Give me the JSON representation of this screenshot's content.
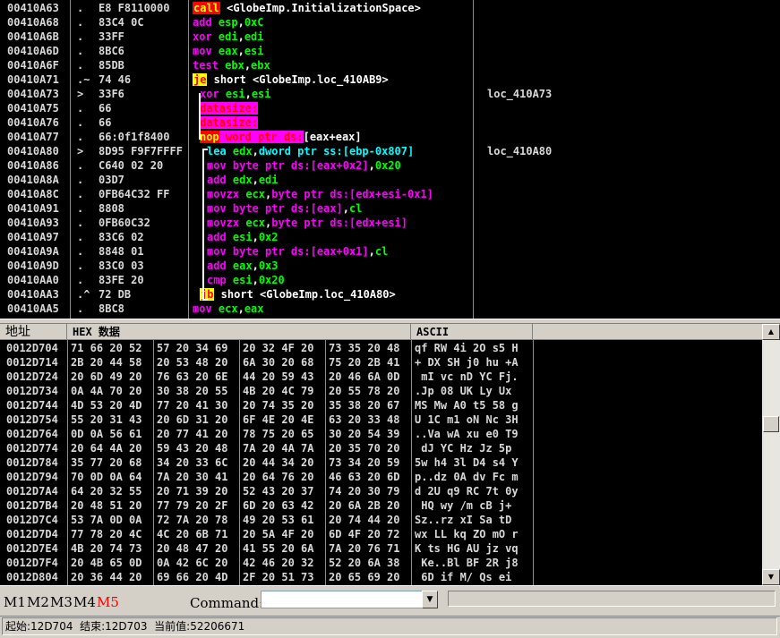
{
  "disasm": {
    "rows": [
      {
        "addr": "00410A63",
        "marker": ".",
        "hex": "E8 F8110000",
        "asm": [
          [
            "kw-call",
            "call"
          ],
          [
            "op-white",
            " <GlobeImp.InitializationSpace>"
          ]
        ],
        "comment": ""
      },
      {
        "addr": "00410A68",
        "marker": ".",
        "hex": "83C4 0C",
        "asm": [
          [
            "kw-add",
            "add "
          ],
          [
            "reg",
            "esp"
          ],
          [
            "op-white",
            ","
          ],
          [
            "num",
            "0xC"
          ]
        ],
        "comment": ""
      },
      {
        "addr": "00410A6B",
        "marker": ".",
        "hex": "33FF",
        "asm": [
          [
            "kw-xor",
            "xor "
          ],
          [
            "reg",
            "edi"
          ],
          [
            "op-white",
            ","
          ],
          [
            "reg",
            "edi"
          ]
        ],
        "comment": ""
      },
      {
        "addr": "00410A6D",
        "marker": ".",
        "hex": "8BC6",
        "asm": [
          [
            "kw-mov",
            "mov "
          ],
          [
            "reg",
            "eax"
          ],
          [
            "op-white",
            ","
          ],
          [
            "reg",
            "esi"
          ]
        ],
        "comment": ""
      },
      {
        "addr": "00410A6F",
        "marker": ".",
        "hex": "85DB",
        "asm": [
          [
            "kw-test",
            "test "
          ],
          [
            "reg",
            "ebx"
          ],
          [
            "op-white",
            ","
          ],
          [
            "reg",
            "ebx"
          ]
        ],
        "comment": ""
      },
      {
        "addr": "00410A71",
        "marker": ".~",
        "hex": "74 46",
        "asm": [
          [
            "kw-jmp",
            "je"
          ],
          [
            "op-white",
            " short <GlobeImp.loc_410AB9>"
          ]
        ],
        "comment": ""
      },
      {
        "addr": "00410A73",
        "marker": ">",
        "hex": "33F6",
        "asm": [
          [
            "kw-xor",
            "xor "
          ],
          [
            "reg",
            "esi"
          ],
          [
            "op-white",
            ","
          ],
          [
            "reg",
            "esi"
          ]
        ],
        "comment": "loc_410A73"
      },
      {
        "addr": "00410A75",
        "marker": ".",
        "hex": "66",
        "asm": [
          [
            "datasize",
            "datasize:"
          ]
        ],
        "comment": ""
      },
      {
        "addr": "00410A76",
        "marker": ".",
        "hex": "66",
        "asm": [
          [
            "datasize",
            "datasize:"
          ]
        ],
        "comment": ""
      },
      {
        "addr": "00410A77",
        "marker": ".",
        "hex": "66:0f1f8400",
        "asm": [
          [
            "nopbox",
            "nop"
          ],
          [
            "nopmag",
            " word ptr ds:"
          ],
          [
            "op-white",
            "[eax+eax]"
          ]
        ],
        "comment": ""
      },
      {
        "addr": "00410A80",
        "marker": ">",
        "hex": "8D95 F9F7FFFF",
        "asm": [
          [
            "kw-lea",
            "lea "
          ],
          [
            "reg",
            "edx"
          ],
          [
            "op-white",
            ","
          ],
          [
            "cyan",
            "dword ptr ss:[ebp-0x807]"
          ]
        ],
        "comment": "loc_410A80"
      },
      {
        "addr": "00410A86",
        "marker": ".",
        "hex": "C640 02 20",
        "asm": [
          [
            "kw-mov",
            "mov "
          ],
          [
            "mag",
            "byte ptr ds:[eax+0x2]"
          ],
          [
            "op-white",
            ","
          ],
          [
            "num",
            "0x20"
          ]
        ],
        "comment": ""
      },
      {
        "addr": "00410A8A",
        "marker": ".",
        "hex": "03D7",
        "asm": [
          [
            "kw-add",
            "add "
          ],
          [
            "reg",
            "edx"
          ],
          [
            "op-white",
            ","
          ],
          [
            "reg",
            "edi"
          ]
        ],
        "comment": ""
      },
      {
        "addr": "00410A8C",
        "marker": ".",
        "hex": "0FB64C32 FF",
        "asm": [
          [
            "kw-movzx",
            "movzx "
          ],
          [
            "reg",
            "ecx"
          ],
          [
            "op-white",
            ","
          ],
          [
            "mag",
            "byte ptr ds:[edx+esi-0x1]"
          ]
        ],
        "comment": ""
      },
      {
        "addr": "00410A91",
        "marker": ".",
        "hex": "8808",
        "asm": [
          [
            "kw-mov",
            "mov "
          ],
          [
            "mag",
            "byte ptr ds:[eax]"
          ],
          [
            "op-white",
            ","
          ],
          [
            "reg",
            "cl"
          ]
        ],
        "comment": ""
      },
      {
        "addr": "00410A93",
        "marker": ".",
        "hex": "0FB60C32",
        "asm": [
          [
            "kw-movzx",
            "movzx "
          ],
          [
            "reg",
            "ecx"
          ],
          [
            "op-white",
            ","
          ],
          [
            "mag",
            "byte ptr ds:[edx+esi]"
          ]
        ],
        "comment": ""
      },
      {
        "addr": "00410A97",
        "marker": ".",
        "hex": "83C6 02",
        "asm": [
          [
            "kw-add",
            "add "
          ],
          [
            "reg",
            "esi"
          ],
          [
            "op-white",
            ","
          ],
          [
            "num",
            "0x2"
          ]
        ],
        "comment": ""
      },
      {
        "addr": "00410A9A",
        "marker": ".",
        "hex": "8848 01",
        "asm": [
          [
            "kw-mov",
            "mov "
          ],
          [
            "mag",
            "byte ptr ds:[eax+0x1]"
          ],
          [
            "op-white",
            ","
          ],
          [
            "reg",
            "cl"
          ]
        ],
        "comment": ""
      },
      {
        "addr": "00410A9D",
        "marker": ".",
        "hex": "83C0 03",
        "asm": [
          [
            "kw-add",
            "add "
          ],
          [
            "reg",
            "eax"
          ],
          [
            "op-white",
            ","
          ],
          [
            "num",
            "0x3"
          ]
        ],
        "comment": ""
      },
      {
        "addr": "00410AA0",
        "marker": ".",
        "hex": "83FE 20",
        "asm": [
          [
            "kw-cmp",
            "cmp "
          ],
          [
            "reg",
            "esi"
          ],
          [
            "op-white",
            ","
          ],
          [
            "num",
            "0x20"
          ]
        ],
        "comment": ""
      },
      {
        "addr": "00410AA3",
        "marker": ".^",
        "hex": "72 DB",
        "asm": [
          [
            "kw-jb",
            "jb"
          ],
          [
            "op-white",
            " short <GlobeImp.loc_410A80>"
          ]
        ],
        "comment": ""
      },
      {
        "addr": "00410AA5",
        "marker": ".",
        "hex": "8BC8",
        "asm": [
          [
            "kw-mov",
            "mov "
          ],
          [
            "reg",
            "ecx"
          ],
          [
            "op-white",
            ","
          ],
          [
            "reg",
            "eax"
          ]
        ],
        "comment": ""
      }
    ]
  },
  "dump": {
    "headers": {
      "address": "地址",
      "hex": "HEX 数据",
      "ascii": "ASCII"
    },
    "rows": [
      {
        "addr": "0012D704",
        "g": [
          "71 66 20 52",
          "57 20 34 69",
          "20 32 4F 20",
          "73 35 20 48"
        ],
        "ascii": "qf RW 4i 2O s5 H"
      },
      {
        "addr": "0012D714",
        "g": [
          "2B 20 44 58",
          "20 53 48 20",
          "6A 30 20 68",
          "75 20 2B 41"
        ],
        "ascii": "+ DX SH j0 hu +A"
      },
      {
        "addr": "0012D724",
        "g": [
          "20 6D 49 20",
          "76 63 20 6E",
          "44 20 59 43",
          "20 46 6A 0D"
        ],
        "ascii": " mI vc nD YC Fj."
      },
      {
        "addr": "0012D734",
        "g": [
          "0A 4A 70 20",
          "30 38 20 55",
          "4B 20 4C 79",
          "20 55 78 20"
        ],
        "ascii": ".Jp 08 UK Ly Ux "
      },
      {
        "addr": "0012D744",
        "g": [
          "4D 53 20 4D",
          "77 20 41 30",
          "20 74 35 20",
          "35 38 20 67"
        ],
        "ascii": "MS Mw A0 t5 58 g"
      },
      {
        "addr": "0012D754",
        "g": [
          "55 20 31 43",
          "20 6D 31 20",
          "6F 4E 20 4E",
          "63 20 33 48"
        ],
        "ascii": "U 1C m1 oN Nc 3H"
      },
      {
        "addr": "0012D764",
        "g": [
          "0D 0A 56 61",
          "20 77 41 20",
          "78 75 20 65",
          "30 20 54 39"
        ],
        "ascii": "..Va wA xu e0 T9"
      },
      {
        "addr": "0012D774",
        "g": [
          "20 64 4A 20",
          "59 43 20 48",
          "7A 20 4A 7A",
          "20 35 70 20"
        ],
        "ascii": " dJ YC Hz Jz 5p "
      },
      {
        "addr": "0012D784",
        "g": [
          "35 77 20 68",
          "34 20 33 6C",
          "20 44 34 20",
          "73 34 20 59"
        ],
        "ascii": "5w h4 3l D4 s4 Y"
      },
      {
        "addr": "0012D794",
        "g": [
          "70 0D 0A 64",
          "7A 20 30 41",
          "20 64 76 20",
          "46 63 20 6D"
        ],
        "ascii": "p..dz 0A dv Fc m"
      },
      {
        "addr": "0012D7A4",
        "g": [
          "64 20 32 55",
          "20 71 39 20",
          "52 43 20 37",
          "74 20 30 79"
        ],
        "ascii": "d 2U q9 RC 7t 0y"
      },
      {
        "addr": "0012D7B4",
        "g": [
          "20 48 51 20",
          "77 79 20 2F",
          "6D 20 63 42",
          "20 6A 2B 20"
        ],
        "ascii": " HQ wy /m cB j+ "
      },
      {
        "addr": "0012D7C4",
        "g": [
          "53 7A 0D 0A",
          "72 7A 20 78",
          "49 20 53 61",
          "20 74 44 20"
        ],
        "ascii": "Sz..rz xI Sa tD "
      },
      {
        "addr": "0012D7D4",
        "g": [
          "77 78 20 4C",
          "4C 20 6B 71",
          "20 5A 4F 20",
          "6D 4F 20 72"
        ],
        "ascii": "wx LL kq ZO mO r"
      },
      {
        "addr": "0012D7E4",
        "g": [
          "4B 20 74 73",
          "20 48 47 20",
          "41 55 20 6A",
          "7A 20 76 71"
        ],
        "ascii": "K ts HG AU jz vq"
      },
      {
        "addr": "0012D7F4",
        "g": [
          "20 4B 65 0D",
          "0A 42 6C 20",
          "42 46 20 32",
          "52 20 6A 38"
        ],
        "ascii": " Ke..Bl BF 2R j8"
      },
      {
        "addr": "0012D804",
        "g": [
          "20 36 44 20",
          "69 66 20 4D",
          "2F 20 51 73",
          "20 65 69 20"
        ],
        "ascii": " 6D if M/ Qs ei "
      }
    ]
  },
  "command": {
    "buttons": [
      "M1",
      "M2",
      "M3",
      "M4",
      "M5"
    ],
    "active": "M5",
    "label": "Command:",
    "input_value": ""
  },
  "status": {
    "text": "起始:12D704  结束:12D703  当前值:52206671"
  }
}
